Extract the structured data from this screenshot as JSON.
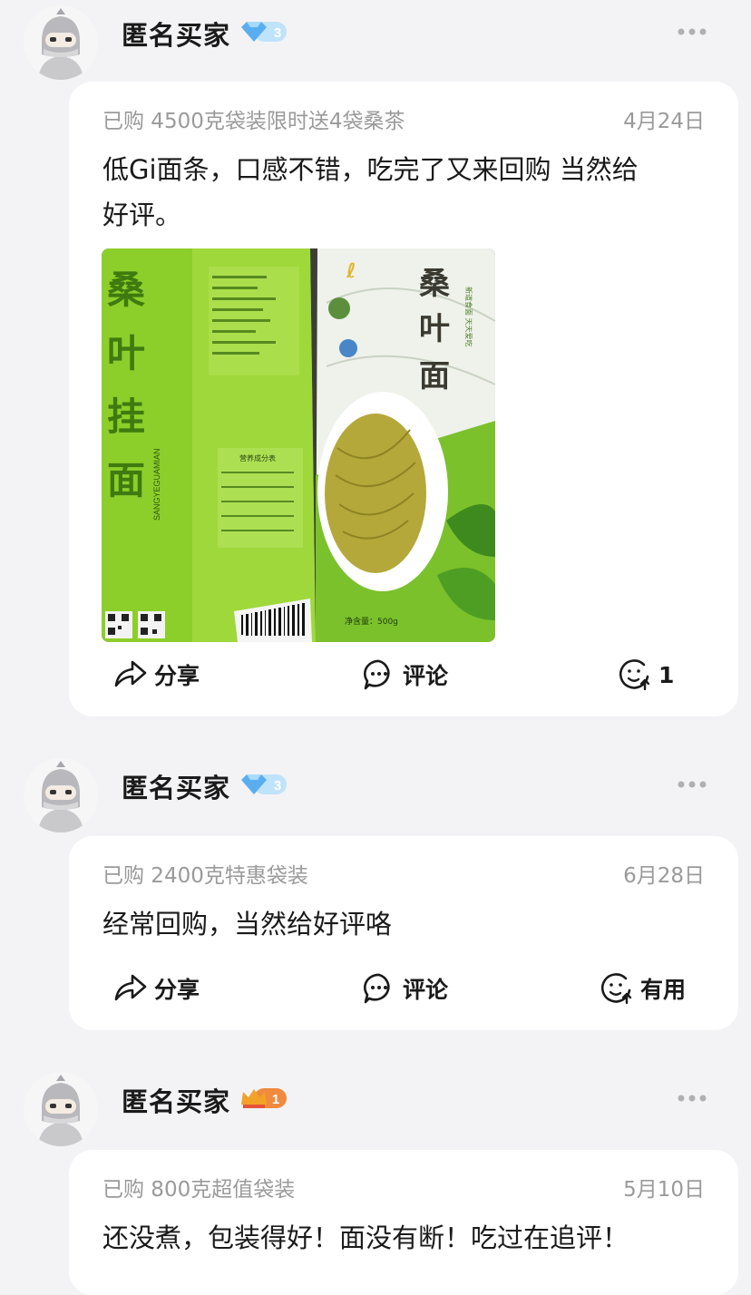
{
  "reviews": [
    {
      "username": "匿名买家",
      "badge": {
        "type": "diamond",
        "level": "3"
      },
      "sku": "已购 4500克袋装限时送4袋桑茶",
      "date": "4月24日",
      "text_lines": [
        "低Gi面条，口感不错，吃完了又来回购 当然给",
        "好评。"
      ],
      "photo": {
        "left_pack_text": "桑叶挂面",
        "right_pack_text": "桑叶面",
        "slogan": "新道食面 天天爱吃",
        "nutrition_title": "营养成分表",
        "net_weight": "净含量：500g",
        "pack_latin": "SANGYEGUAMIAN"
      },
      "actions": {
        "share": "分享",
        "comment": "评论",
        "useful": "1"
      }
    },
    {
      "username": "匿名买家",
      "badge": {
        "type": "diamond",
        "level": "3"
      },
      "sku": "已购 2400克特惠袋装",
      "date": "6月28日",
      "text_lines": [
        "经常回购，当然给好评咯"
      ],
      "actions": {
        "share": "分享",
        "comment": "评论",
        "useful": "有用"
      }
    },
    {
      "username": "匿名买家",
      "badge": {
        "type": "crown",
        "level": "1"
      },
      "sku": "已购 800克超值袋装",
      "date": "5月10日",
      "text_lines": [
        "还没煮，包装得好！面没有断！吃过在追评！"
      ]
    }
  ],
  "colors": {
    "background": "#f3f3f5",
    "card": "#ffffff",
    "muted": "#9a9a9a",
    "diamond": "#5aaef0",
    "crown": "#f08a3c",
    "pack_green": "#8ccf2a"
  },
  "icons": [
    "more-icon",
    "share-icon",
    "comment-icon",
    "useful-icon",
    "diamond-badge-icon",
    "crown-badge-icon",
    "avatar-icon"
  ]
}
